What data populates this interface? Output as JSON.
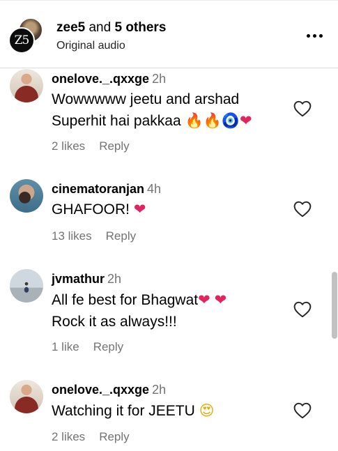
{
  "header": {
    "account_name": "zee5",
    "and_text": "and",
    "others": "5 others",
    "subtitle": "Original audio",
    "logo_text": "Z5"
  },
  "comments": [
    {
      "username": "onelove._.qxxge",
      "time": "2h",
      "lines": [
        "Wowwwww jeetu and arshad",
        "Superhit hai pakkaa"
      ],
      "likes": "2 likes",
      "reply": "Reply"
    },
    {
      "username": "cinematoranjan",
      "time": "4h",
      "lines": [
        "GHAFOOR!"
      ],
      "likes": "13 likes",
      "reply": "Reply"
    },
    {
      "username": "jvmathur",
      "time": "2h",
      "lines": [
        "All fe best for Bhagwat",
        "Rock it as always!!!"
      ],
      "likes": "1 like",
      "reply": "Reply"
    },
    {
      "username": "onelove._.qxxge",
      "time": "2h",
      "lines": [
        "Watching it for JEETU"
      ],
      "likes": "2 likes",
      "reply": "Reply"
    }
  ],
  "emoji": {
    "fire": "🔥",
    "evil_eye": "🧿",
    "heart": "❤",
    "heart_eyes": "😍"
  },
  "icons": {
    "more": "more-options-icon",
    "like": "heart-outline-icon"
  },
  "colors": {
    "meta_text": "#737373",
    "divider": "#dbdbdb",
    "heart_emoji": "#e0245e"
  }
}
